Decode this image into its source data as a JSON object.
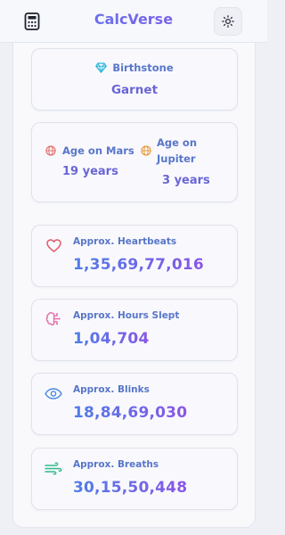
{
  "header": {
    "title": "CalcVerse",
    "left_icon": "calculator-icon",
    "right_icon": "sun-icon"
  },
  "birthstone": {
    "label": "Birthstone",
    "value": "Garnet",
    "icon": "gem-icon",
    "icon_color": "#2bb5d8"
  },
  "planets": [
    {
      "label_line1": "Age on Mars",
      "label_line2": "",
      "value": "19 years",
      "icon": "globe-icon",
      "icon_color": "#e2706a"
    },
    {
      "label_line1": "Age on",
      "label_line2": "Jupiter",
      "value": "3 years",
      "icon": "globe-icon",
      "icon_color": "#e99a3c"
    }
  ],
  "stats": [
    {
      "label": "Approx. Heartbeats",
      "value": "1,35,69,77,016",
      "icon": "heart-icon",
      "icon_color": "#e05a6a"
    },
    {
      "label": "Approx. Hours Slept",
      "value": "1,04,704",
      "icon": "brain-icon",
      "icon_color": "#e56fa8"
    },
    {
      "label": "Approx. Blinks",
      "value": "18,84,69,030",
      "icon": "eye-icon",
      "icon_color": "#4b87e0"
    },
    {
      "label": "Approx. Breaths",
      "value": "30,15,50,448",
      "icon": "wind-icon",
      "icon_color": "#2fba8a"
    }
  ]
}
